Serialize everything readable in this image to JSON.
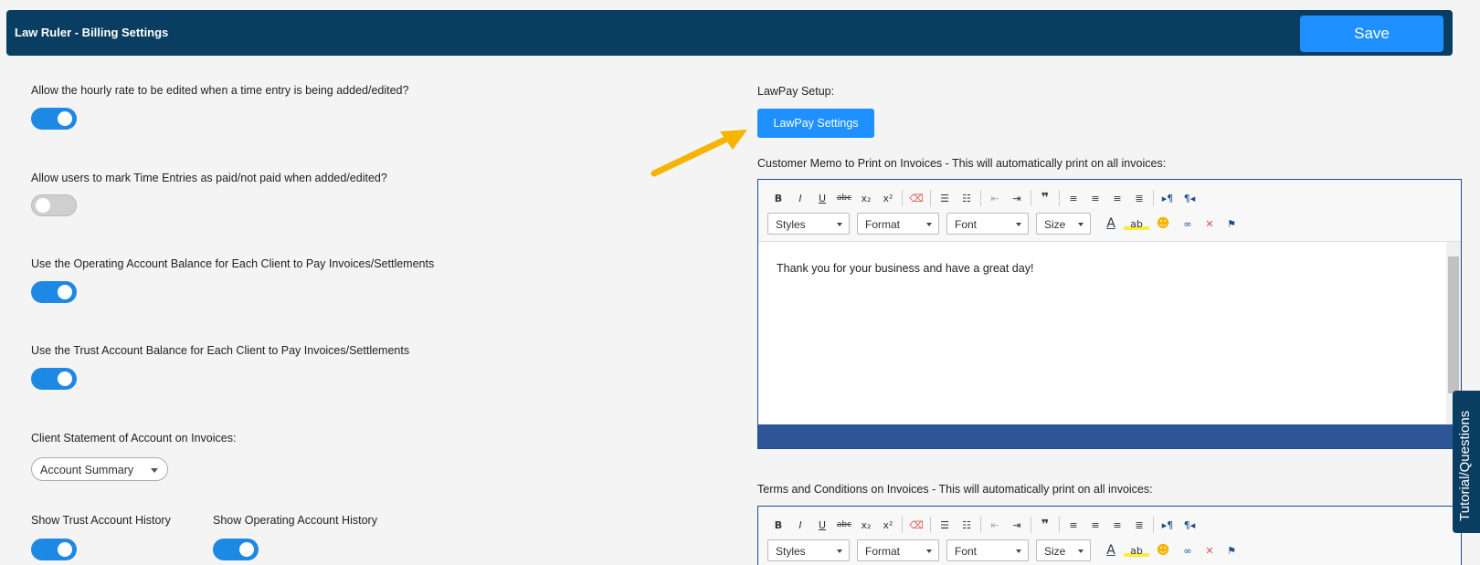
{
  "header": {
    "title": "Law Ruler - Billing Settings",
    "save_label": "Save"
  },
  "settings": {
    "hourly_rate": {
      "label": "Allow the hourly rate to be edited when a time entry is being added/edited?",
      "enabled": true
    },
    "mark_paid": {
      "label": "Allow users to mark Time Entries as paid/not paid when added/edited?",
      "enabled": false
    },
    "operating_balance": {
      "label": "Use the Operating Account Balance for Each Client to Pay Invoices/Settlements",
      "enabled": true
    },
    "trust_balance": {
      "label": "Use the Trust Account Balance for Each Client to Pay Invoices/Settlements",
      "enabled": true
    },
    "statement": {
      "label": "Client Statement of Account on Invoices:",
      "selected": "Account Summary"
    },
    "trust_history": {
      "label": "Show Trust Account History",
      "enabled": true
    },
    "operating_history": {
      "label": "Show Operating Account History",
      "enabled": true
    }
  },
  "lawpay": {
    "label": "LawPay Setup:",
    "button_label": "LawPay Settings"
  },
  "memo": {
    "label": "Customer Memo to Print on Invoices - This will automatically print on all invoices:",
    "content": "Thank you for your business and have a great day!"
  },
  "terms": {
    "label": "Terms and Conditions on Invoices - This will automatically print on all invoices:"
  },
  "toolbar": {
    "bold": "B",
    "italic": "I",
    "underline": "U",
    "strike": "abc",
    "subscript": "x₂",
    "superscript": "x²",
    "styles": "Styles",
    "format": "Format",
    "font": "Font",
    "size": "Size",
    "text_color": "A",
    "bg_color": "ab"
  },
  "side_tab": {
    "label": "Tutorial/Questions"
  },
  "colors": {
    "header": "#0a3d62",
    "accent": "#1e90ff",
    "arrow": "#f4b400"
  }
}
